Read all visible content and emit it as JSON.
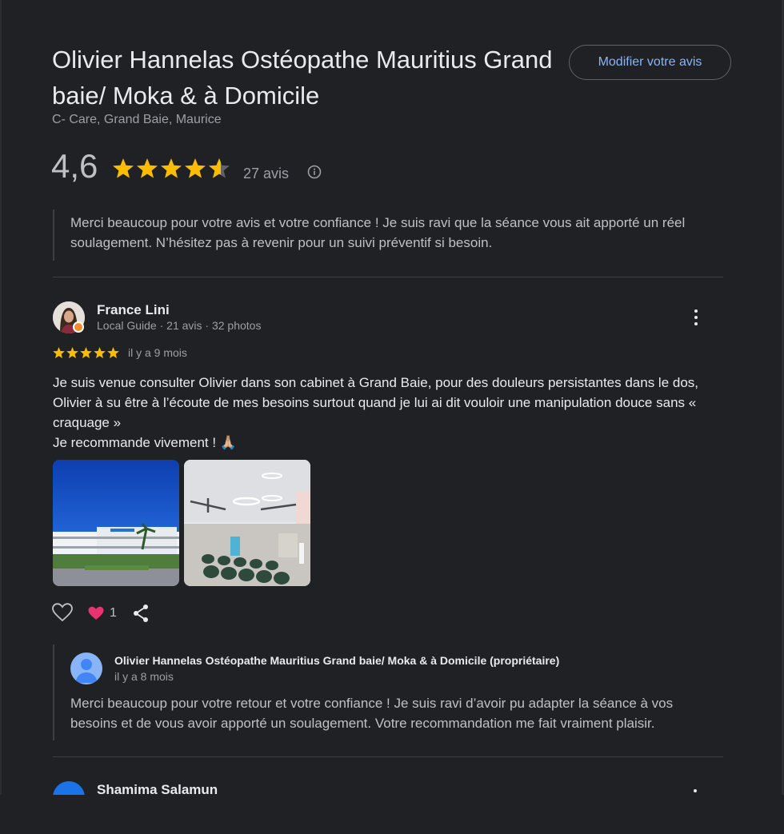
{
  "place": {
    "title": "Olivier Hannelas Ostéopathe Mauritius Grand baie/ Moka & à Domicile",
    "subtitle": "C- Care, Grand Baie, Maurice",
    "edit_button": "Modifier votre avis",
    "rating": "4,6",
    "rating_value": 4.6,
    "review_count": "27 avis"
  },
  "own_reply_excerpt": "Merci beaucoup pour votre avis et votre confiance ! Je suis ravi que la séance vous ait apporté un réel soulagement. N’hésitez pas à revenir pour un suivi préventif si besoin.",
  "review": {
    "author": "France Lini",
    "meta": "Local Guide · 21 avis · 32 photos",
    "stars": 5,
    "date": "il y a 9 mois",
    "text": "Je suis venue consulter Olivier dans son cabinet à Grand Baie, pour des douleurs persistantes dans le dos, Olivier à su être à l’écoute de mes besoins surtout quand je lui ai dit vouloir une manipulation douce sans « craquage »\nJe recommande vivement ! 🙏🏼",
    "like_count": "1",
    "owner_reply": {
      "name": "Olivier Hannelas Ostéopathe Mauritius Grand baie/ Moka & à Domicile (propriétaire)",
      "date": "il y a 8 mois",
      "text": "Merci beaucoup pour votre retour et votre confiance ! Je suis ravi d’avoir pu adapter la séance à vos besoins et de vous avoir apporté un soulagement. Votre recommandation me fait vraiment plaisir."
    }
  },
  "next_review": {
    "author": "Shamima Salamun"
  },
  "colors": {
    "background": "#202124",
    "star": "#fbbc04",
    "link": "#8ab4f8",
    "heart": "#e8336f"
  },
  "icons": [
    "info-icon",
    "more-vert-icon",
    "heart-outline-icon",
    "heart-filled-icon",
    "share-icon"
  ]
}
